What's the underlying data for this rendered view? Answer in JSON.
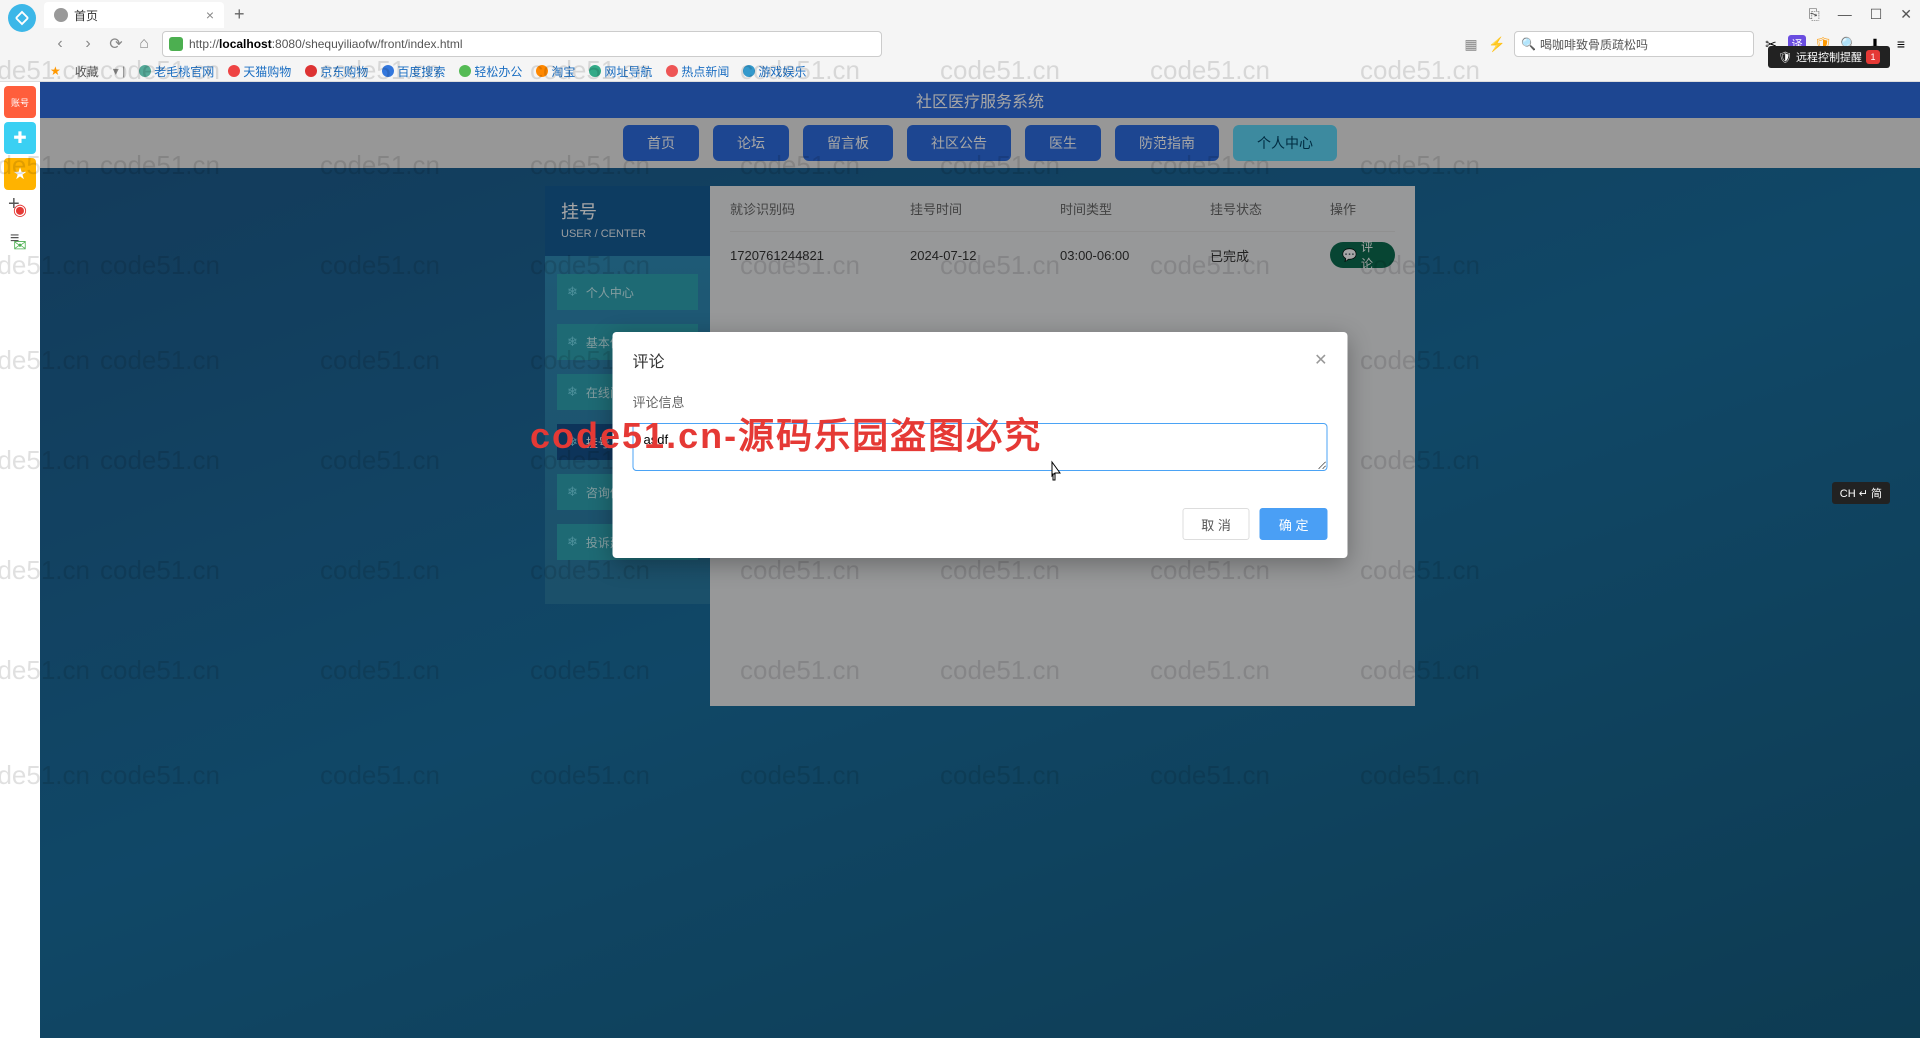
{
  "browser": {
    "tab_title": "首页",
    "url_prefix": "http://",
    "url_host": "localhost",
    "url_rest": ":8080/shequyiliaofw/front/index.html",
    "search_text": "喝咖啡致骨质疏松吗",
    "bookmarks_label": "收藏",
    "bookmarks": [
      "老毛桃官网",
      "天猫购物",
      "京东购物",
      "百度搜索",
      "轻松办公",
      "淘宝",
      "网址导航",
      "热点新闻",
      "游戏娱乐"
    ]
  },
  "remote_badge": "远程控制提醒",
  "ime_badge": "CH ↵ 简",
  "app": {
    "title": "社区医疗服务系统",
    "nav": [
      "首页",
      "论坛",
      "留言板",
      "社区公告",
      "医生",
      "防范指南",
      "个人中心"
    ],
    "active_nav": 6
  },
  "sidebar": {
    "title": "挂号",
    "subtitle": "USER / CENTER",
    "items": [
      {
        "label": "个人中心",
        "active": false
      },
      {
        "label": "基本信息",
        "active": false
      },
      {
        "label": "在线问诊",
        "active": false
      },
      {
        "label": "挂号",
        "active": true
      },
      {
        "label": "咨询信息",
        "active": false
      },
      {
        "label": "投诉建议",
        "active": false
      }
    ]
  },
  "table": {
    "headers": {
      "id": "就诊识别码",
      "time": "挂号时间",
      "type": "时间类型",
      "status": "挂号状态",
      "action": "操作"
    },
    "rows": [
      {
        "id": "1720761244821",
        "time": "2024-07-12",
        "type": "03:00-06:00",
        "status": "已完成",
        "action": "评论"
      }
    ]
  },
  "modal": {
    "title": "评论",
    "field_label": "评论信息",
    "value": "asdf",
    "cancel": "取 消",
    "confirm": "确 定"
  },
  "watermark_text": "code51.cn",
  "watermark_red": "code51.cn-源码乐园盗图必究"
}
